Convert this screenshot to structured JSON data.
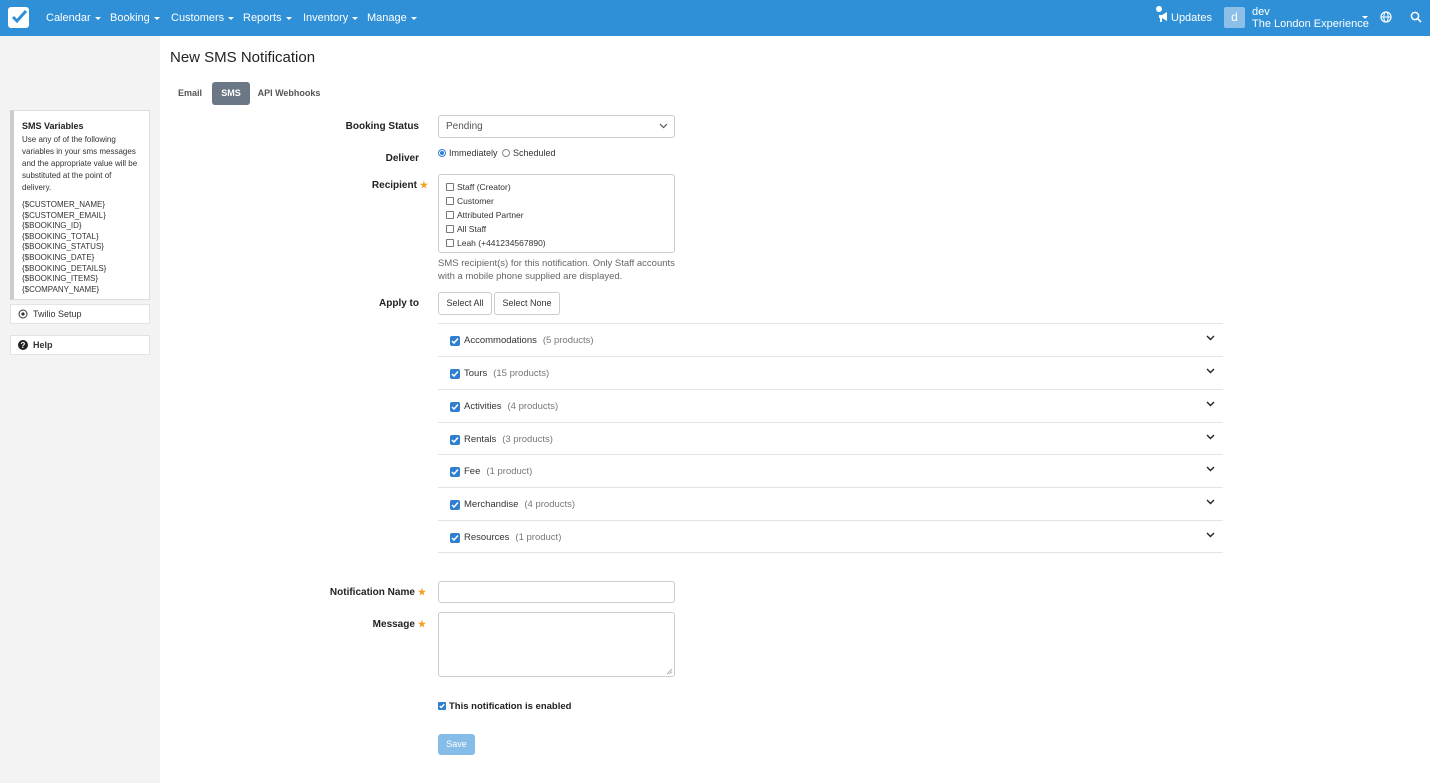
{
  "nav": {
    "items": [
      "Calendar",
      "Booking",
      "Customers",
      "Reports",
      "Inventory",
      "Manage"
    ],
    "updates": "Updates",
    "avatar_letter": "d",
    "user_name": "dev",
    "company": "The London Experience"
  },
  "sidebar": {
    "vars_title": "SMS Variables",
    "vars_desc": "Use any of of the following variables in your sms messages and the appropriate value will be substituted at the point of delivery.",
    "variables": [
      "{$CUSTOMER_NAME}",
      "{$CUSTOMER_EMAIL}",
      "{$BOOKING_ID}",
      "{$BOOKING_TOTAL}",
      "{$BOOKING_STATUS}",
      "{$BOOKING_DATE}",
      "{$BOOKING_DETAILS}",
      "{$BOOKING_ITEMS}",
      "{$COMPANY_NAME}"
    ],
    "twilio": "Twilio Setup",
    "help": "Help"
  },
  "page": {
    "title": "New SMS Notification",
    "tabs": [
      "Email",
      "SMS",
      "API Webhooks"
    ]
  },
  "form": {
    "booking_status_label": "Booking Status",
    "booking_status_value": "Pending",
    "deliver_label": "Deliver",
    "deliver_options": [
      "Immediately",
      "Scheduled"
    ],
    "recipient_label": "Recipient",
    "recipients": [
      "Staff (Creator)",
      "Customer",
      "Attributed Partner",
      "All Staff",
      "Leah (+441234567890)"
    ],
    "recipient_help": "SMS recipient(s) for this notification. Only Staff accounts with a mobile phone supplied are displayed.",
    "apply_label": "Apply to",
    "select_all": "Select All",
    "select_none": "Select None",
    "categories": [
      {
        "name": "Accommodations",
        "count": "(5 products)"
      },
      {
        "name": "Tours",
        "count": "(15 products)"
      },
      {
        "name": "Activities",
        "count": "(4 products)"
      },
      {
        "name": "Rentals",
        "count": "(3 products)"
      },
      {
        "name": "Fee",
        "count": "(1 product)"
      },
      {
        "name": "Merchandise",
        "count": "(4 products)"
      },
      {
        "name": "Resources",
        "count": "(1 product)"
      }
    ],
    "name_label": "Notification Name",
    "message_label": "Message",
    "enabled_label": "This notification is enabled",
    "save": "Save",
    "required_mark": "★"
  },
  "colors": {
    "nav": "#2f90d8",
    "accent": "#2f7fd0",
    "active_tab": "#6b7785",
    "save": "#86bde8"
  }
}
